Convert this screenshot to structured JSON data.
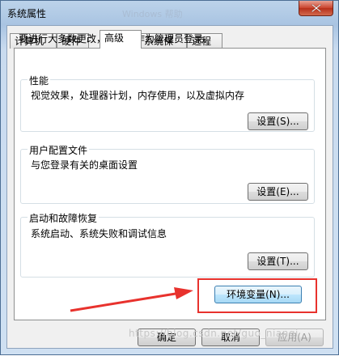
{
  "window": {
    "title": "系统属性",
    "background_title": "Windows 帮助"
  },
  "tabs": [
    {
      "label": "计算机名"
    },
    {
      "label": "硬件"
    },
    {
      "label": "高级",
      "active": true
    },
    {
      "label": "系统保护"
    },
    {
      "label": "远程"
    }
  ],
  "advanced": {
    "intro": "要进行大多数更改，您必须作为管理员登录。",
    "performance": {
      "title": "性能",
      "description": "视觉效果，处理器计划，内存使用，以及虚拟内存",
      "button": "设置(S)..."
    },
    "user_profiles": {
      "title": "用户配置文件",
      "description": "与您登录有关的桌面设置",
      "button": "设置(E)..."
    },
    "startup_recovery": {
      "title": "启动和故障恢复",
      "description": "系统启动、系统失败和调试信息",
      "button": "设置(T)..."
    },
    "env_vars_button": "环境变量(N)..."
  },
  "footer": {
    "ok": "确定",
    "cancel": "取消",
    "apply": "应用(A)"
  },
  "watermark": "https://blog.csdn.net/guo_nianqi",
  "colors": {
    "annotation_red": "#e8322d",
    "close_button": "#c9422c"
  },
  "icons": {
    "close": "close-icon"
  }
}
